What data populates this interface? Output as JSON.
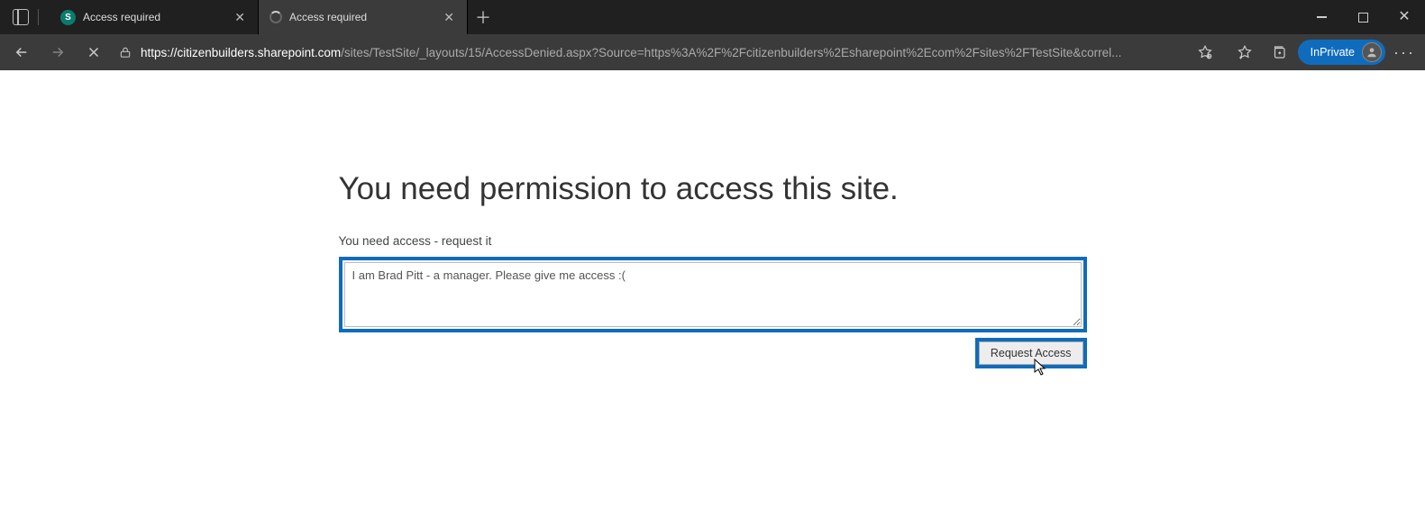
{
  "window": {
    "tabs": [
      {
        "favicon": "S",
        "title": "Access required"
      },
      {
        "favicon": "spinner",
        "title": "Access required"
      }
    ],
    "controls": {
      "minimize": "min",
      "maximize": "max",
      "close": "close"
    }
  },
  "toolbar": {
    "url_domain": "https://citizenbuilders.sharepoint.com",
    "url_path": "/sites/TestSite/_layouts/15/AccessDenied.aspx?Source=https%3A%2F%2Fcitizenbuilders%2Esharepoint%2Ecom%2Fsites%2FTestSite&correl...",
    "inprivate_label": "InPrivate"
  },
  "page": {
    "heading": "You need permission to access this site.",
    "subtext": "You need access - request it",
    "message_value": "I am Brad Pitt - a manager. Please give me access :(",
    "request_button_label": "Request Access"
  }
}
